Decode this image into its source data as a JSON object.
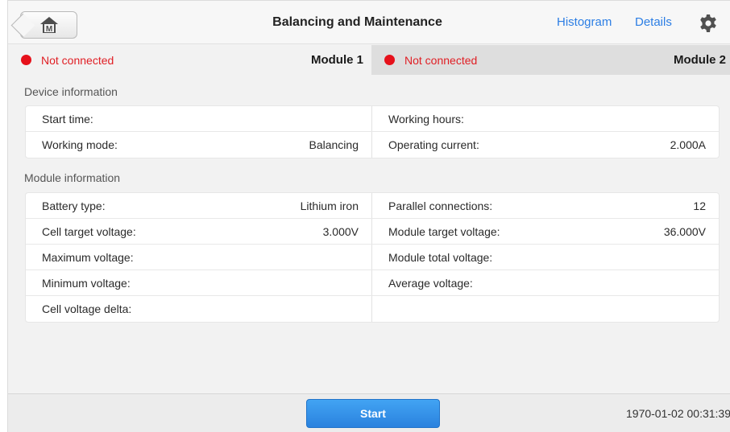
{
  "header": {
    "title": "Balancing and Maintenance",
    "histogram_label": "Histogram",
    "details_label": "Details",
    "home_logo_letter": "M",
    "accent_color": "#2c7ee4"
  },
  "tabs": [
    {
      "status": "Not connected",
      "name": "Module 1",
      "active": true
    },
    {
      "status": "Not connected",
      "name": "Module 2",
      "active": false
    }
  ],
  "device_info": {
    "label": "Device information",
    "rows": [
      {
        "left_label": "Start time:",
        "left_value": "",
        "right_label": "Working hours:",
        "right_value": ""
      },
      {
        "left_label": "Working mode:",
        "left_value": "Balancing",
        "right_label": "Operating current:",
        "right_value": "2.000A"
      }
    ]
  },
  "module_info": {
    "label": "Module information",
    "rows": [
      {
        "left_label": "Battery type:",
        "left_value": "Lithium iron",
        "right_label": "Parallel connections:",
        "right_value": "12"
      },
      {
        "left_label": "Cell target voltage:",
        "left_value": "3.000V",
        "right_label": "Module target voltage:",
        "right_value": "36.000V"
      },
      {
        "left_label": "Maximum voltage:",
        "left_value": "",
        "right_label": "Module total voltage:",
        "right_value": ""
      },
      {
        "left_label": "Minimum voltage:",
        "left_value": "",
        "right_label": "Average voltage:",
        "right_value": ""
      },
      {
        "left_label": "Cell voltage delta:",
        "left_value": "",
        "right_label": "",
        "right_value": ""
      }
    ]
  },
  "footer": {
    "start_label": "Start",
    "timestamp": "1970-01-02 00:31:39"
  },
  "colors": {
    "status_red": "#e6111b",
    "start_blue": "#2a82de"
  }
}
